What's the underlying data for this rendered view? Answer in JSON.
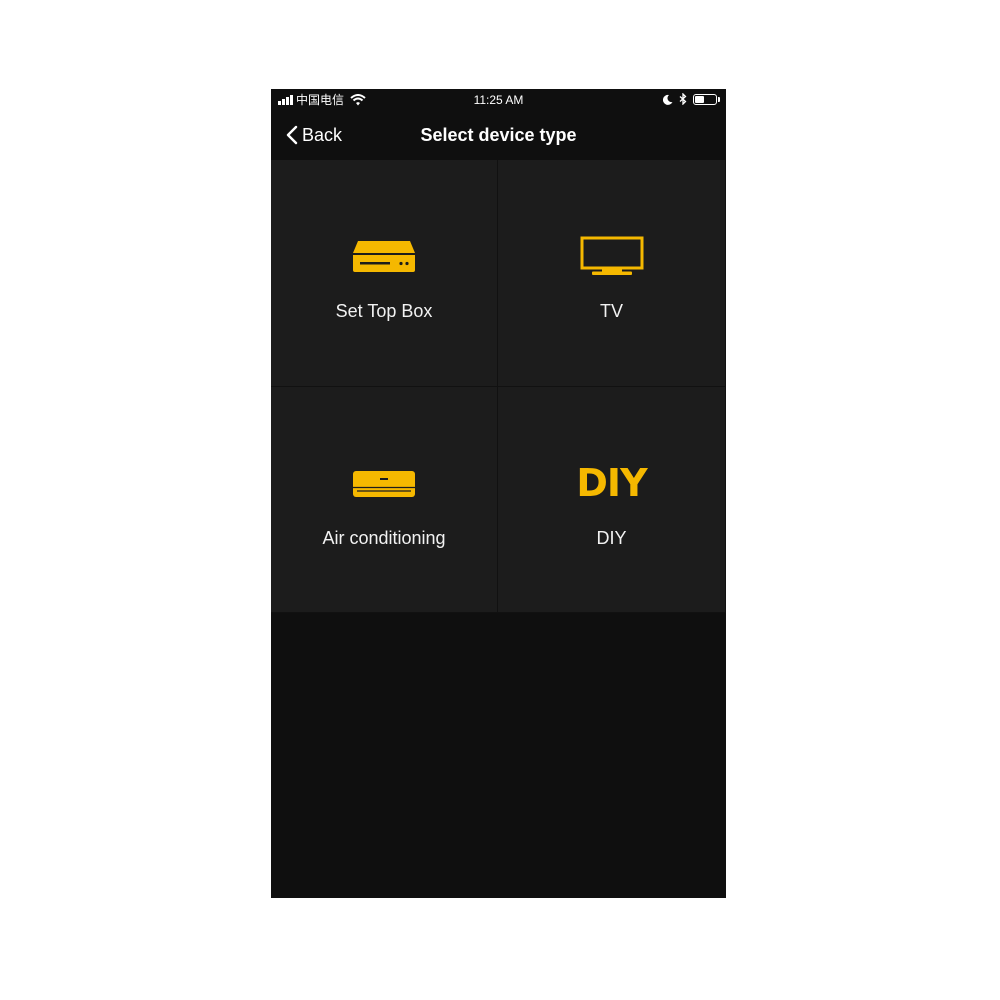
{
  "colors": {
    "accent": "#f5b800",
    "background": "#0f0f0f",
    "tile": "#1c1c1c",
    "text": "#f2f2f2"
  },
  "status_bar": {
    "carrier": "中国电信",
    "time": "11:25 AM",
    "icons": [
      "signal-icon",
      "wifi-icon",
      "moon-icon",
      "bluetooth-icon",
      "battery-icon"
    ]
  },
  "nav": {
    "back_label": "Back",
    "title": "Select device type"
  },
  "devices": [
    {
      "label": "Set Top Box",
      "icon": "set-top-box-icon"
    },
    {
      "label": "TV",
      "icon": "tv-icon"
    },
    {
      "label": "Air conditioning",
      "icon": "air-conditioner-icon"
    },
    {
      "label": "DIY",
      "icon": "diy-icon",
      "icon_text": "DIY"
    }
  ]
}
